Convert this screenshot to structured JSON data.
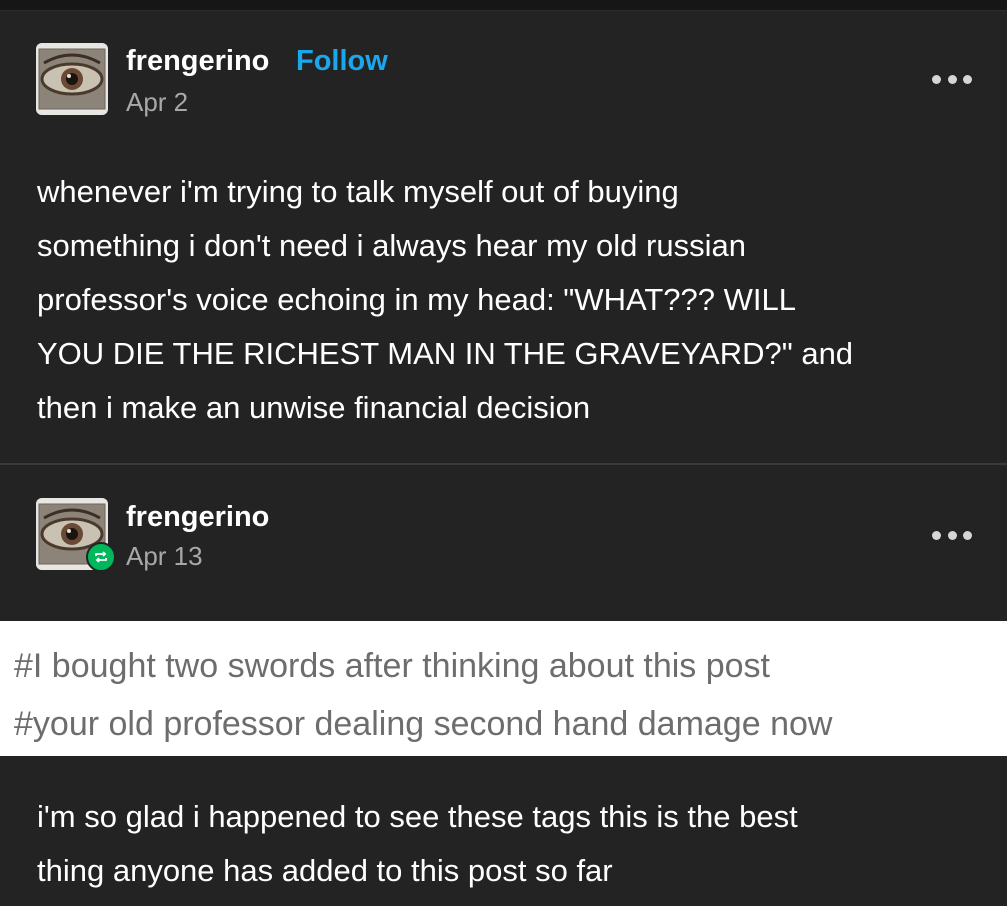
{
  "posts": [
    {
      "username": "frengerino",
      "follow_label": "Follow",
      "date": "Apr 2",
      "body_lines": [
        "whenever i'm trying to talk myself out of buying",
        "something i don't need i always hear my old russian",
        "professor's voice echoing in my head: \"WHAT??? WILL",
        "YOU DIE THE RICHEST MAN IN THE GRAVEYARD?\" and",
        "then i make an unwise financial decision"
      ]
    },
    {
      "username": "frengerino",
      "date": "Apr 13",
      "tags": [
        "#I bought two swords after thinking about this post",
        "#your old professor dealing second hand damage now"
      ],
      "body_lines": [
        "i'm so glad i happened to see these tags this is the best",
        "thing anyone has added to this post so far"
      ]
    }
  ],
  "icons": {
    "avatar": "eye-mosaic-avatar",
    "more": "more-options-icon",
    "reblog": "reblog-icon"
  },
  "colors": {
    "background": "#232323",
    "follow": "#1aa7ec",
    "reblog_badge": "#00b85c",
    "tag_text": "#6d6d6d"
  }
}
